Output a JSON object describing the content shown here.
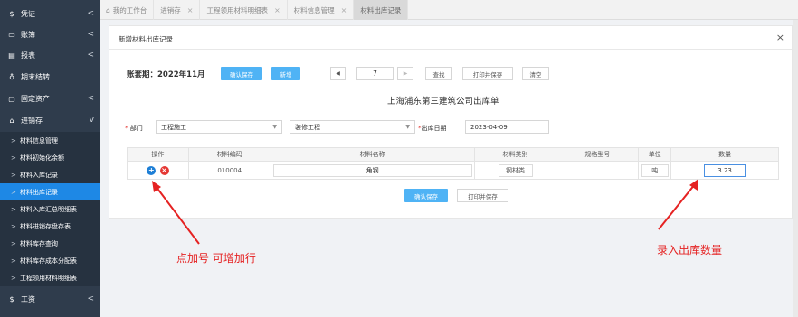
{
  "sidebar": {
    "top_items": [
      {
        "icon": "dollar-icon",
        "glyph": "$",
        "label": "凭证",
        "chev": "<"
      },
      {
        "icon": "book-icon",
        "glyph": "▭",
        "label": "账簿",
        "chev": "<"
      },
      {
        "icon": "report-icon",
        "glyph": "▤",
        "label": "报表",
        "chev": "<"
      },
      {
        "icon": "period-end-icon",
        "glyph": "♁",
        "label": "期末结转",
        "chev": ""
      },
      {
        "icon": "monitor-icon",
        "glyph": "▢",
        "label": "固定资产",
        "chev": "<"
      },
      {
        "icon": "cart-icon",
        "glyph": "⌂",
        "label": "进销存",
        "chev": "v"
      }
    ],
    "sub_items": [
      "材料信息管理",
      "材料初始化余额",
      "材料入库记录",
      "材料出库记录",
      "材料入库汇总明细表",
      "材料进销存盘存表",
      "材料库存查询",
      "材料库存成本分配表",
      "工程领用材料明细表"
    ],
    "active_sub_index": 3,
    "bottom_item": {
      "icon": "dollar-icon",
      "glyph": "$",
      "label": "工资",
      "chev": "<"
    }
  },
  "tabs": [
    {
      "label": "我的工作台",
      "icon": "home-icon",
      "closable": false
    },
    {
      "label": "进销存",
      "closable": true
    },
    {
      "label": "工程领用材料明细表",
      "closable": true
    },
    {
      "label": "材料信息管理",
      "closable": true
    },
    {
      "label": "材料出库记录",
      "closable": false,
      "active": true
    }
  ],
  "modal": {
    "title": "新增材料出库记录",
    "close": "×",
    "period_label": "账套期：2022年11月",
    "confirm_save": "确认保存",
    "new": "新增",
    "prev": "◀",
    "page": "7",
    "next": "▶",
    "find": "查找",
    "print_save": "打印并保存",
    "clear": "清空",
    "doc_title": "上海浦东第三建筑公司出库单",
    "dept_label": "部门",
    "dept_value": "工程施工",
    "project_value": "装修工程",
    "date_label": "出库日期",
    "date_value": "2023-04-09",
    "req_mark": "*",
    "headers": [
      "操作",
      "材料编码",
      "材料名称",
      "材料类别",
      "规格型号",
      "单位",
      "数量"
    ],
    "row": {
      "code": "010004",
      "name": "角钢",
      "category": "钢材类",
      "spec": "",
      "unit": "吨",
      "qty": "3.23"
    },
    "add_glyph": "+",
    "del_glyph": "×",
    "bottom_confirm": "确认保存",
    "bottom_print": "打印并保存"
  },
  "annotations": {
    "left": "点加号 可增加行",
    "right": "录入出库数量",
    "color": "#e52222"
  }
}
